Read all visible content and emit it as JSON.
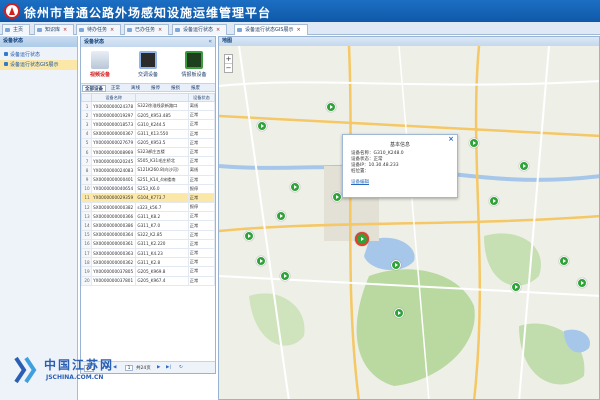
{
  "app": {
    "title": "徐州市普通公路外场感知设施运维管理平台"
  },
  "tabs": [
    {
      "label": "主页",
      "closable": false
    },
    {
      "label": "知识库",
      "closable": true
    },
    {
      "label": "待办任务",
      "closable": true
    },
    {
      "label": "已办任务",
      "closable": true
    },
    {
      "label": "设备运行状态",
      "closable": true
    },
    {
      "label": "设备运行状态GIS展示",
      "closable": true,
      "active": true
    }
  ],
  "sidebar": {
    "title": "设备状态",
    "items": [
      {
        "label": "设备运行状态",
        "active": false
      },
      {
        "label": "设备运行状态GIS展示",
        "active": true
      }
    ]
  },
  "panel": {
    "title": "设备状态",
    "categories": [
      {
        "label": "视频设备",
        "active": true
      },
      {
        "label": "交调设备",
        "active": false
      },
      {
        "label": "情报板设备",
        "active": false
      }
    ],
    "subtabs": [
      "全部设备",
      "正常",
      "离线",
      "报停",
      "报损",
      "报废"
    ],
    "columns": [
      "设备名称",
      "设备状态"
    ],
    "rows": [
      {
        "no": "1",
        "name": "YX0000000024378",
        "location": "S322徐淮线泉新路口",
        "status": "离线"
      },
      {
        "no": "2",
        "name": "YX0000000019297",
        "location": "G205_K953.485",
        "status": "正常"
      },
      {
        "no": "3",
        "name": "YX0000000018573",
        "location": "G310_K244.5",
        "status": "正常"
      },
      {
        "no": "4",
        "name": "SX0000000000367",
        "location": "G311_K13.550",
        "status": "正常"
      },
      {
        "no": "5",
        "name": "YX0000000027679",
        "location": "G205_K953.5",
        "status": "正常"
      },
      {
        "no": "6",
        "name": "YX0000000008969",
        "location": "S323郝庄五楼",
        "status": "正常"
      },
      {
        "no": "7",
        "name": "YX0000000020245",
        "location": "S505_K31毛庄桥北",
        "status": "正常"
      },
      {
        "no": "8",
        "name": "YX0000000024083",
        "location": "S121K260.8(向沙河)",
        "status": "离线"
      },
      {
        "no": "9",
        "name": "SX0000000000401",
        "location": "S251_K14_4宋楼南",
        "status": "正常"
      },
      {
        "no": "10",
        "name": "YX0000000040654",
        "location": "S253_K6.0",
        "status": "报停"
      },
      {
        "no": "11",
        "name": "YX0000000029359",
        "location": "G104_K773.7",
        "status": "正常"
      },
      {
        "no": "12",
        "name": "SX0000000000382",
        "location": "s323_k56.7",
        "status": "报停"
      },
      {
        "no": "13",
        "name": "SX0000000000366",
        "location": "G311_K8.2",
        "status": "正常"
      },
      {
        "no": "14",
        "name": "SX0000000000386",
        "location": "G311_K7.0",
        "status": "正常"
      },
      {
        "no": "15",
        "name": "SX0000000000364",
        "location": "S322_K2.85",
        "status": "正常"
      },
      {
        "no": "16",
        "name": "SX0000000000361",
        "location": "G311_K2.220",
        "status": "正常"
      },
      {
        "no": "17",
        "name": "SX0000000000363",
        "location": "G311_K4.23",
        "status": "正常"
      },
      {
        "no": "18",
        "name": "SX0000000000362",
        "location": "G311_K2.8",
        "status": "正常"
      },
      {
        "no": "19",
        "name": "YX0000000037805",
        "location": "G205_K969.8",
        "status": "正常"
      },
      {
        "no": "20",
        "name": "YX0000000037801",
        "location": "G205_K967.4",
        "status": "正常"
      }
    ],
    "selected_row": 11,
    "pager": {
      "page_size": "20",
      "current": "1",
      "total_label": "共24页"
    }
  },
  "map": {
    "title": "地图",
    "zoom_in": "+",
    "zoom_out": "−",
    "popup": {
      "title": "基本信息",
      "lines": [
        "设备名称：G310_K248.0",
        "设备状态：正常",
        "设备IP：10.30.48.233",
        "桩位置："
      ],
      "link": "设备编辑"
    }
  },
  "watermark": {
    "text": "中国江苏网",
    "url": "JSCHINA.COM.CN"
  }
}
